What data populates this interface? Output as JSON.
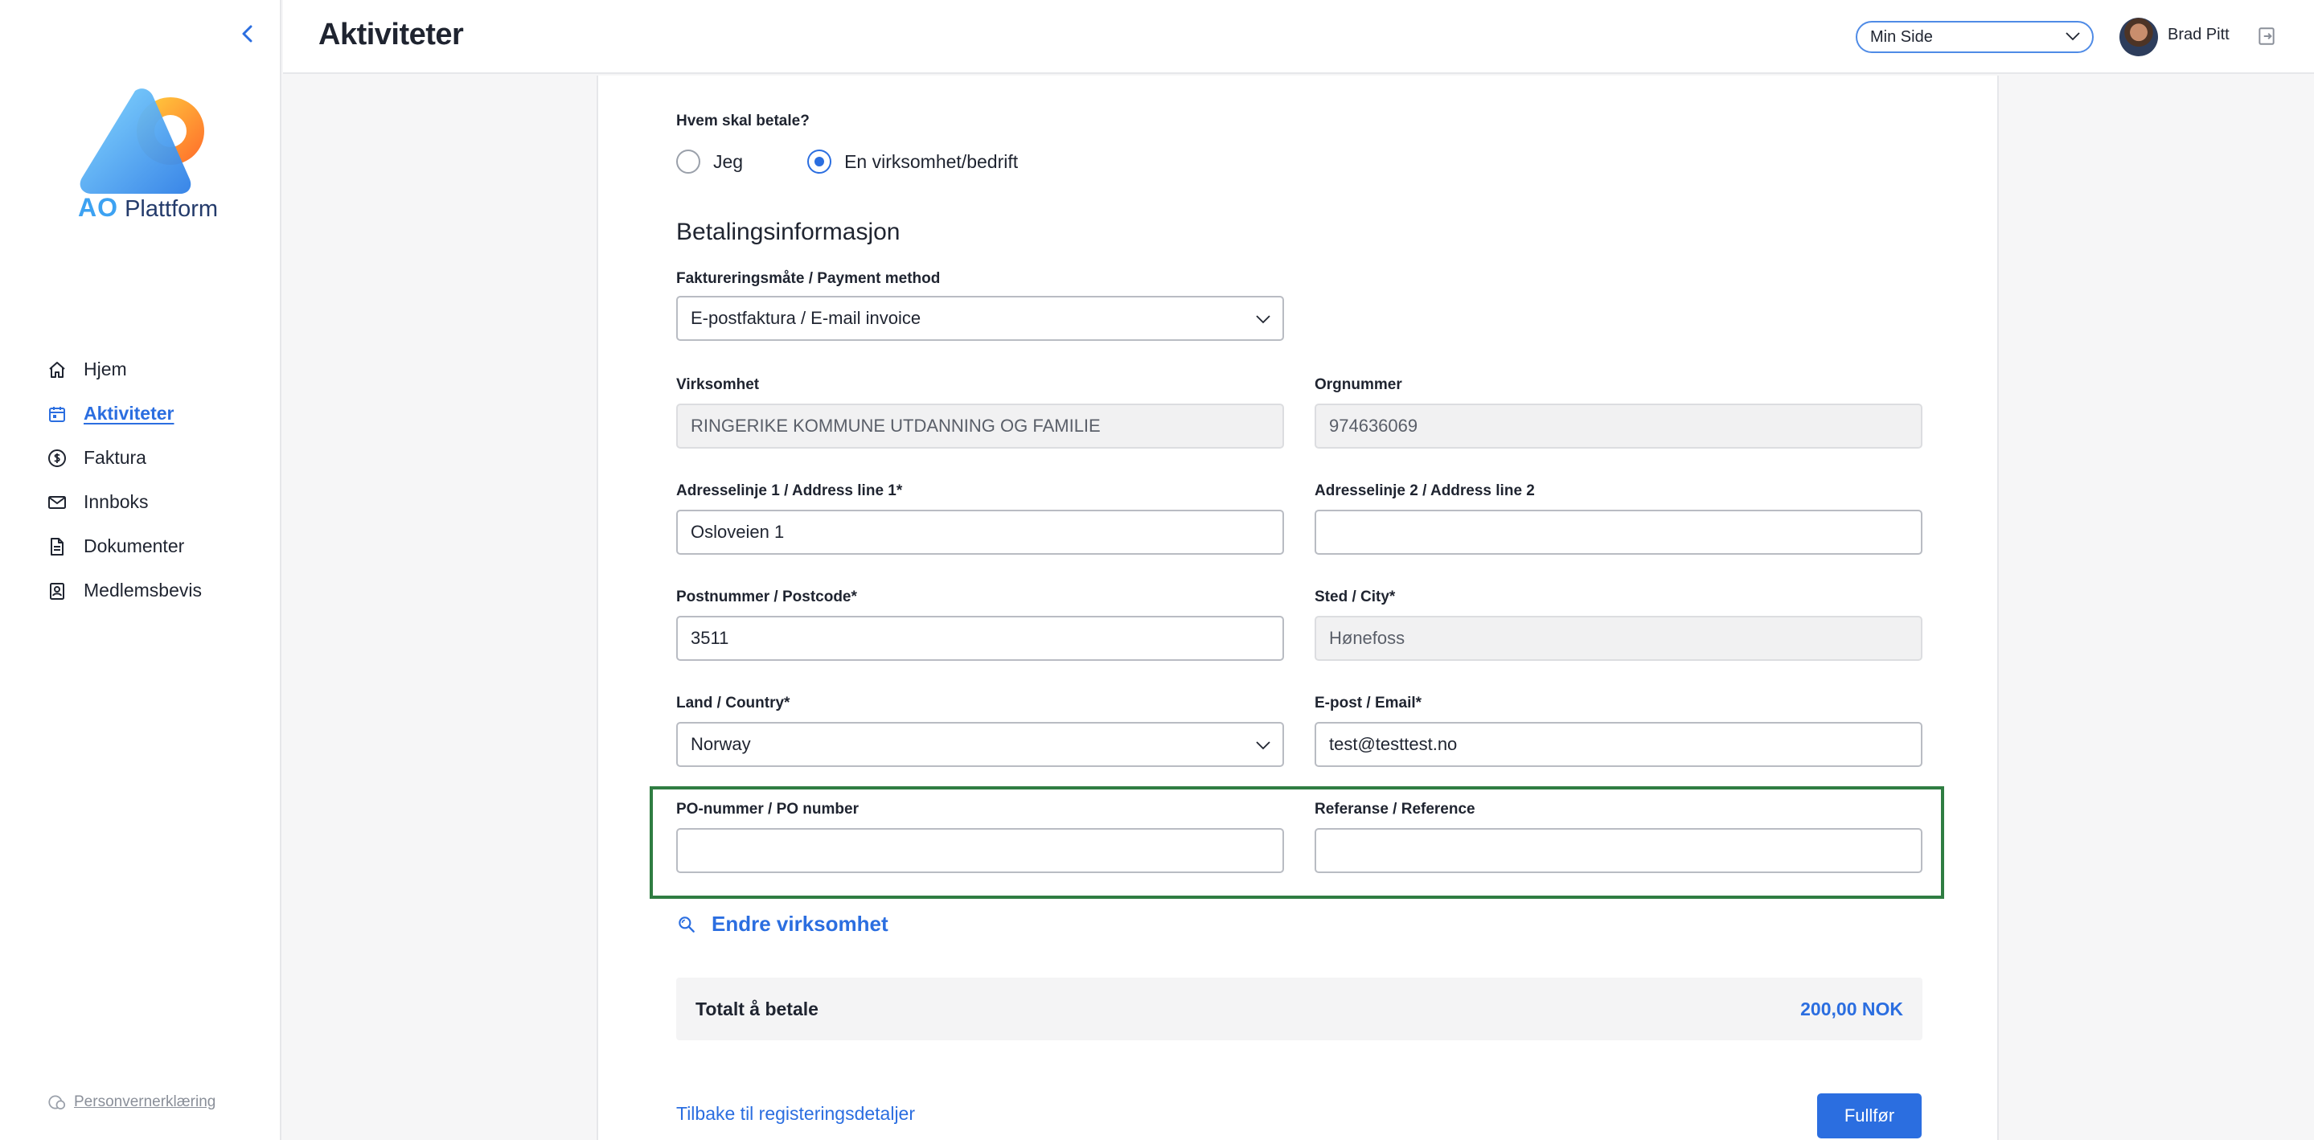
{
  "sidebar": {
    "logo_ao": "AO",
    "logo_name": "Plattform",
    "items": [
      {
        "label": "Hjem",
        "icon": "home-icon"
      },
      {
        "label": "Aktiviteter",
        "icon": "calendar-icon",
        "active": true
      },
      {
        "label": "Faktura",
        "icon": "dollar-icon"
      },
      {
        "label": "Innboks",
        "icon": "mail-icon"
      },
      {
        "label": "Dokumenter",
        "icon": "document-icon"
      },
      {
        "label": "Medlemsbevis",
        "icon": "id-card-icon"
      }
    ],
    "privacy_label": "Personvernerklæring"
  },
  "header": {
    "title": "Aktiviteter",
    "select_value": "Min Side",
    "user_name": "Brad Pitt"
  },
  "form": {
    "payer_question": "Hvem skal betale?",
    "payer_options": [
      {
        "label": "Jeg",
        "checked": false
      },
      {
        "label": "En virksomhet/bedrift",
        "checked": true
      }
    ],
    "section_title": "Betalingsinformasjon",
    "payment_method": {
      "label": "Faktureringsmåte / Payment method",
      "value": "E-postfaktura / E-mail invoice"
    },
    "company": {
      "label": "Virksomhet",
      "value": "RINGERIKE KOMMUNE UTDANNING OG FAMILIE"
    },
    "org_number": {
      "label": "Orgnummer",
      "value": "974636069"
    },
    "address1": {
      "label": "Adresselinje 1 / Address line 1*",
      "value": "Osloveien 1"
    },
    "address2": {
      "label": "Adresselinje 2 / Address line 2",
      "value": ""
    },
    "postcode": {
      "label": "Postnummer / Postcode*",
      "value": "3511"
    },
    "city": {
      "label": "Sted / City*",
      "value": "Hønefoss"
    },
    "country": {
      "label": "Land / Country*",
      "value": "Norway"
    },
    "email": {
      "label": "E-post / Email*",
      "value": "test@testtest.no"
    },
    "po_number": {
      "label": "PO-nummer / PO number",
      "value": ""
    },
    "reference": {
      "label": "Referanse / Reference",
      "value": ""
    },
    "change_company": "Endre virksomhet",
    "total_label": "Totalt å betale",
    "total_value": "200,00 NOK",
    "back_label": "Tilbake til registeringsdetaljer",
    "finish_label": "Fullfør"
  },
  "colors": {
    "accent": "#2b6ee0",
    "highlight_border": "#2f7d42"
  }
}
